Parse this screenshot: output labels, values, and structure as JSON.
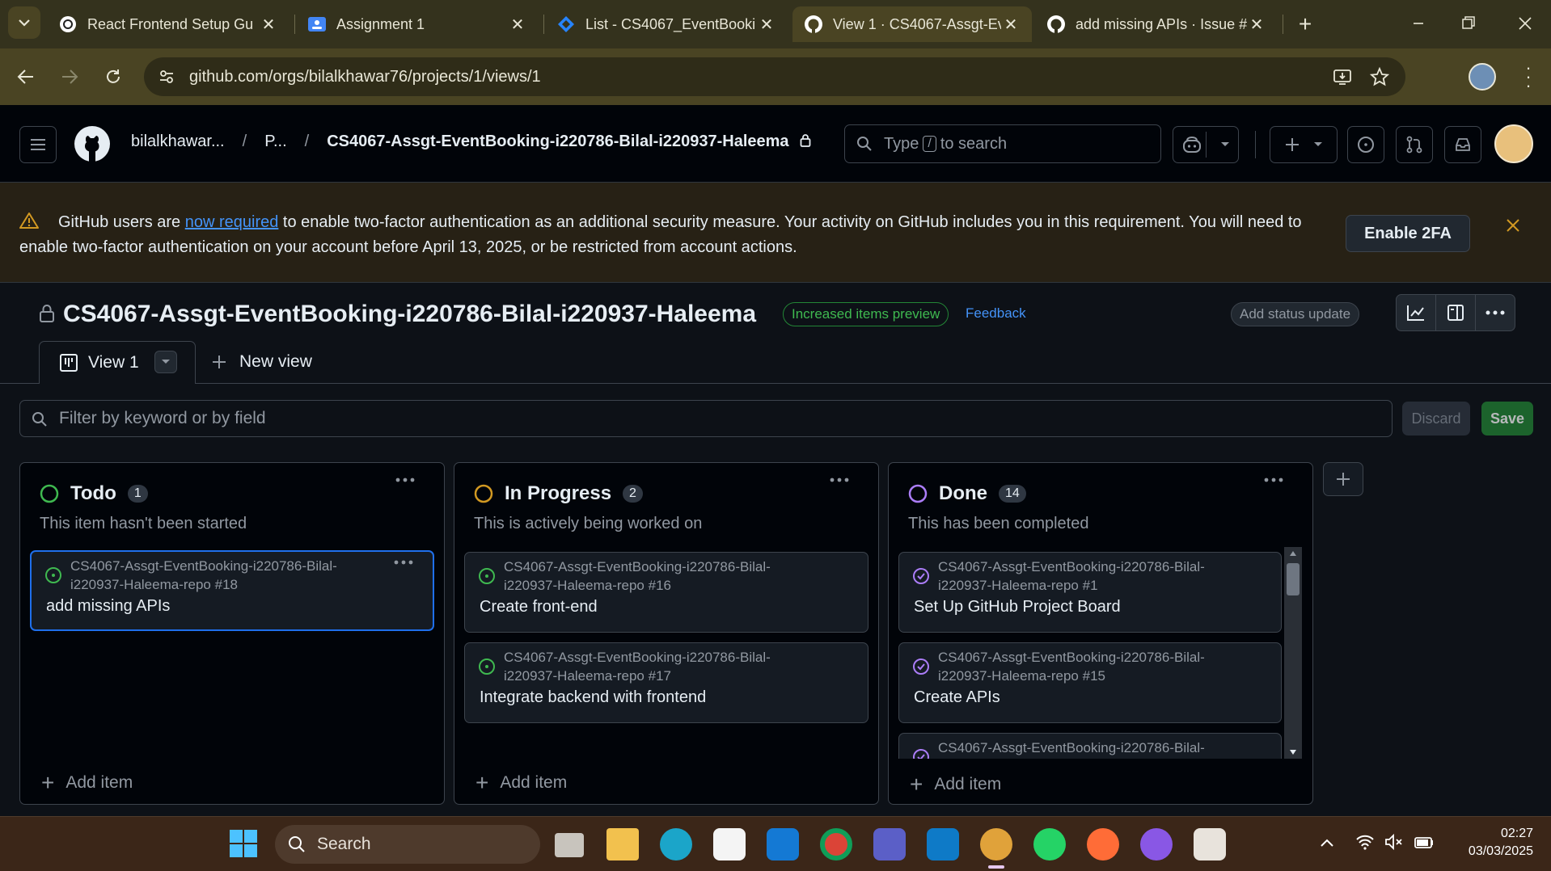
{
  "browser": {
    "tabs": [
      {
        "title": "React Frontend Setup Gu",
        "icon": "chatgpt-icon"
      },
      {
        "title": "Assignment 1",
        "icon": "classroom-icon"
      },
      {
        "title": "List - CS4067_EventBooki",
        "icon": "jira-icon"
      },
      {
        "title": "View 1 · CS4067-Assgt-Ev",
        "icon": "github-icon",
        "active": true
      },
      {
        "title": "add missing APIs · Issue #",
        "icon": "github-icon"
      }
    ],
    "url": "github.com/orgs/bilalkhawar76/projects/1/views/1"
  },
  "header": {
    "org": "bilalkhawar...",
    "projects_short": "P...",
    "project": "CS4067-Assgt-EventBooking-i220786-Bilal-i220937-Haleema",
    "search_prefix": "Type",
    "search_key": "/",
    "search_suffix": "to search"
  },
  "banner": {
    "text_before": "GitHub users are",
    "link": "now required",
    "text_after": "to enable two-factor authentication as an additional security measure. Your activity on GitHub includes you in this requirement. You will need to enable two-factor authentication on your account before April 13, 2025, or be restricted from account actions.",
    "button": "Enable 2FA"
  },
  "project": {
    "title": "CS4067-Assgt-EventBooking-i220786-Bilal-i220937-Haleema",
    "preview_label": "Increased items preview",
    "feedback": "Feedback",
    "status_update": "Add status update",
    "view_tab": "View 1",
    "new_view": "New view",
    "filter_placeholder": "Filter by keyword or by field",
    "discard": "Discard",
    "save": "Save"
  },
  "columns": [
    {
      "name": "Todo",
      "count": "1",
      "description": "This item hasn't been started",
      "color": "#3fb950",
      "add_item": "Add item",
      "cards": [
        {
          "ref": "CS4067-Assgt-EventBooking-i220786-Bilal-i220937-Haleema-repo #18",
          "title": "add missing APIs",
          "state": "open"
        }
      ]
    },
    {
      "name": "In Progress",
      "count": "2",
      "description": "This is actively being worked on",
      "color": "#d29922",
      "add_item": "Add item",
      "cards": [
        {
          "ref": "CS4067-Assgt-EventBooking-i220786-Bilal-i220937-Haleema-repo #16",
          "title": "Create front-end",
          "state": "open"
        },
        {
          "ref": "CS4067-Assgt-EventBooking-i220786-Bilal-i220937-Haleema-repo #17",
          "title": "Integrate backend with frontend",
          "state": "open"
        }
      ]
    },
    {
      "name": "Done",
      "count": "14",
      "description": "This has been completed",
      "color": "#ab7df8",
      "add_item": "Add item",
      "cards": [
        {
          "ref": "CS4067-Assgt-EventBooking-i220786-Bilal-i220937-Haleema-repo #1",
          "title": "Set Up GitHub Project Board",
          "state": "closed"
        },
        {
          "ref": "CS4067-Assgt-EventBooking-i220786-Bilal-i220937-Haleema-repo #15",
          "title": "Create APIs",
          "state": "closed"
        },
        {
          "ref": "CS4067-Assgt-EventBooking-i220786-Bilal-",
          "title": "",
          "state": "closed"
        }
      ]
    }
  ],
  "taskbar": {
    "search": "Search",
    "time": "02:27",
    "date": "03/03/2025"
  }
}
